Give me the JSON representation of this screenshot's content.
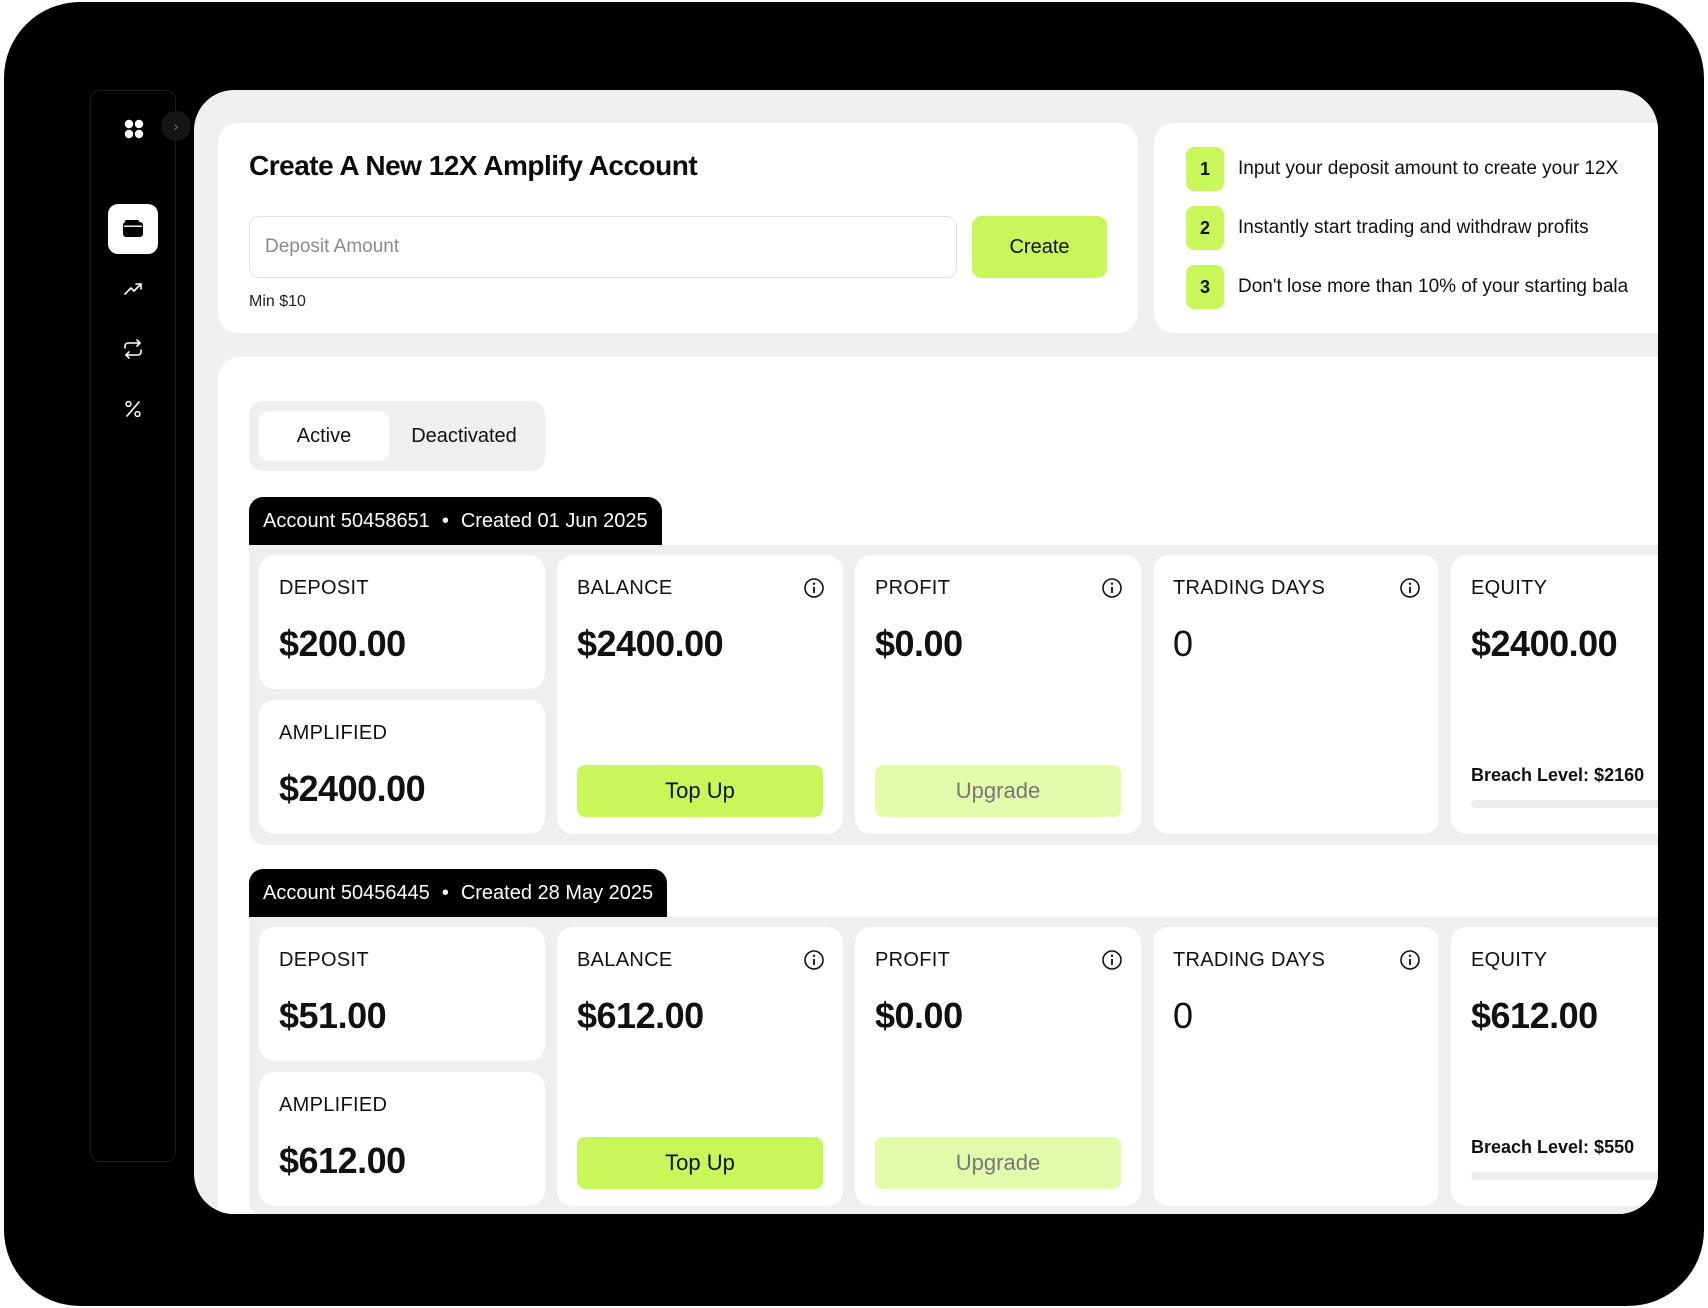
{
  "create": {
    "title": "Create A New 12X Amplify Account",
    "deposit_placeholder": "Deposit Amount",
    "create_label": "Create",
    "min_note": "Min $10"
  },
  "steps": [
    {
      "num": "1",
      "text": "Input your deposit amount to create your 12X"
    },
    {
      "num": "2",
      "text": "Instantly start trading and withdraw profits"
    },
    {
      "num": "3",
      "text": "Don't lose more than 10% of your starting bala"
    }
  ],
  "tabs": {
    "active": "Active",
    "deactivated": "Deactivated"
  },
  "accounts": [
    {
      "account": "Account 50458651",
      "created": "Created 01 Jun 2025",
      "deposit_label": "DEPOSIT",
      "deposit": "$200.00",
      "amplified_label": "AMPLIFIED",
      "amplified": "$2400.00",
      "balance_label": "BALANCE",
      "balance": "$2400.00",
      "profit_label": "PROFIT",
      "profit": "$0.00",
      "days_label": "TRADING DAYS",
      "days": "0",
      "equity_label": "EQUITY",
      "equity": "$2400.00",
      "topup_label": "Top Up",
      "upgrade_label": "Upgrade",
      "breach": "Breach Level: $2160"
    },
    {
      "account": "Account 50456445",
      "created": "Created 28 May 2025",
      "deposit_label": "DEPOSIT",
      "deposit": "$51.00",
      "amplified_label": "AMPLIFIED",
      "amplified": "$612.00",
      "balance_label": "BALANCE",
      "balance": "$612.00",
      "profit_label": "PROFIT",
      "profit": "$0.00",
      "days_label": "TRADING DAYS",
      "days": "0",
      "equity_label": "EQUITY",
      "equity": "$612.00",
      "topup_label": "Top Up",
      "upgrade_label": "Upgrade",
      "breach": "Breach Level: $550"
    }
  ],
  "sidebar": {
    "logo": "grid-logo-icon",
    "items": [
      {
        "icon": "wallet-icon",
        "active": true
      },
      {
        "icon": "trending-up-icon",
        "active": false
      },
      {
        "icon": "repeat-icon",
        "active": false
      },
      {
        "icon": "percent-icon",
        "active": false
      }
    ]
  },
  "colors": {
    "accent": "#c8f75a",
    "accent_muted": "#e4faab",
    "frame": "#000000",
    "panel": "#f0f0f0"
  }
}
